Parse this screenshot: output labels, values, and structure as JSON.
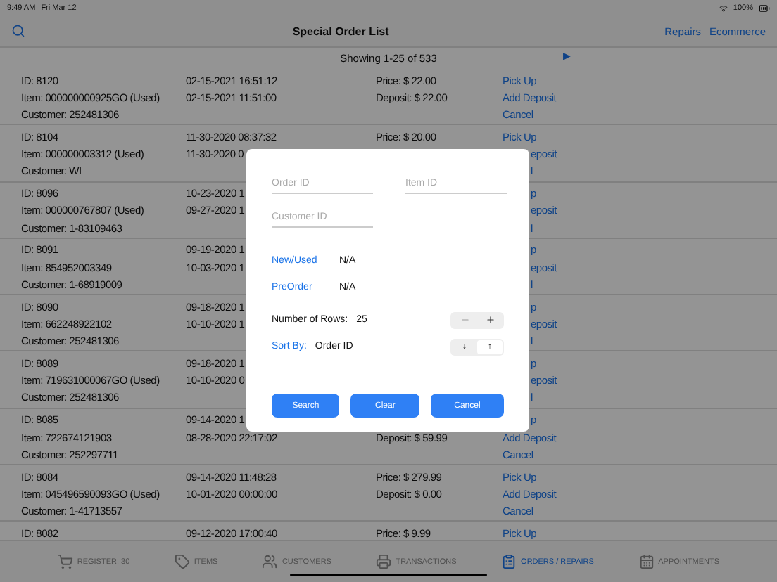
{
  "status_bar": {
    "time": "9:49 AM",
    "date": "Fri Mar 12",
    "battery": "100%"
  },
  "nav": {
    "title": "Special Order List",
    "links": [
      "Repairs",
      "Ecommerce"
    ]
  },
  "pager": {
    "text": "Showing 1-25 of 533",
    "next": "▶"
  },
  "orders": [
    {
      "lines": [
        {
          "info": "ID: 8120",
          "date": "02-15-2021 16:51:12",
          "amount": "Price: $ 22.00",
          "action": "Pick Up"
        },
        {
          "info": "Item: 000000000925GO (Used)",
          "date": "02-15-2021 11:51:00",
          "amount": "Deposit: $ 22.00",
          "action": "Add Deposit"
        },
        {
          "info": "Customer: 252481306",
          "action": "Cancel"
        }
      ]
    },
    {
      "lines": [
        {
          "info": "ID: 8104",
          "date": "11-30-2020 08:37:32",
          "amount": "Price: $ 20.00",
          "action": "Pick Up"
        },
        {
          "info": "Item: 000000003312 (Used)",
          "date": "11-30-2020 0",
          "action_tail": "eposit"
        },
        {
          "info": "Customer: WI",
          "action_tail": "l"
        }
      ]
    },
    {
      "lines": [
        {
          "info": "ID: 8096",
          "date": "10-23-2020 1",
          "action_tail": "p"
        },
        {
          "info": "Item: 000000767807 (Used)",
          "date": "09-27-2020 1",
          "action_tail": "eposit"
        },
        {
          "info": "Customer: 1-83109463",
          "action_tail": "l"
        }
      ]
    },
    {
      "lines": [
        {
          "info": "ID: 8091",
          "date": "09-19-2020 1",
          "action_tail": "p"
        },
        {
          "info": "Item: 854952003349",
          "date": "10-03-2020 1",
          "action_tail": "eposit"
        },
        {
          "info": "Customer: 1-68919009",
          "action_tail": "l"
        }
      ]
    },
    {
      "lines": [
        {
          "info": "ID: 8090",
          "date": "09-18-2020 1",
          "action_tail": "p"
        },
        {
          "info": "Item: 662248922102",
          "date": "10-10-2020 1",
          "action_tail": "eposit"
        },
        {
          "info": "Customer: 252481306",
          "action_tail": "l"
        }
      ]
    },
    {
      "lines": [
        {
          "info": "ID: 8089",
          "date": "09-18-2020 1",
          "action_tail": "p"
        },
        {
          "info": "Item: 719631000067GO (Used)",
          "date": "10-10-2020 0",
          "action_tail": "eposit"
        },
        {
          "info": "Customer: 252481306",
          "action_tail": "l"
        }
      ]
    },
    {
      "lines": [
        {
          "info": "ID: 8085",
          "date": "09-14-2020 1",
          "action_tail": "p"
        },
        {
          "info": "Item: 722674121903",
          "date": "08-28-2020 22:17:02",
          "amount": "Deposit: $ 59.99",
          "action": "Add Deposit"
        },
        {
          "info": "Customer: 252297711",
          "action": "Cancel"
        }
      ]
    },
    {
      "lines": [
        {
          "info": "ID: 8084",
          "date": "09-14-2020 11:48:28",
          "amount": "Price: $ 279.99",
          "action": "Pick Up"
        },
        {
          "info": "Item: 045496590093GO (Used)",
          "date": "10-01-2020 00:00:00",
          "amount": "Deposit: $ 0.00",
          "action": "Add Deposit"
        },
        {
          "info": "Customer: 1-41713557",
          "action": "Cancel"
        }
      ]
    },
    {
      "lines": [
        {
          "info": "ID: 8082",
          "date": "09-12-2020 17:00:40",
          "amount": "Price: $ 9.99",
          "action": "Pick Up"
        }
      ]
    }
  ],
  "dialog": {
    "fields": [
      {
        "placeholder": "Order ID"
      },
      {
        "placeholder": "Item ID"
      },
      {
        "placeholder": "Customer ID"
      }
    ],
    "options": [
      {
        "label": "New/Used",
        "value": "N/A"
      },
      {
        "label": "PreOrder",
        "value": "N/A"
      }
    ],
    "rows": {
      "label": "Number of Rows:",
      "value": "25"
    },
    "sort": {
      "label": "Sort By:",
      "value": "Order ID",
      "segments": [
        {
          "label": "↓",
          "selected": false
        },
        {
          "label": "↑",
          "selected": true
        }
      ]
    },
    "buttons": [
      "Search",
      "Clear",
      "Cancel"
    ]
  },
  "tabs": [
    {
      "label": "REGISTER: 30",
      "selected": false
    },
    {
      "label": "ITEMS",
      "selected": false
    },
    {
      "label": "CUSTOMERS",
      "selected": false
    },
    {
      "label": "TRANSACTIONS",
      "selected": false
    },
    {
      "label": "ORDERS / REPAIRS",
      "selected": true
    },
    {
      "label": "APPOINTMENTS",
      "selected": false
    }
  ]
}
